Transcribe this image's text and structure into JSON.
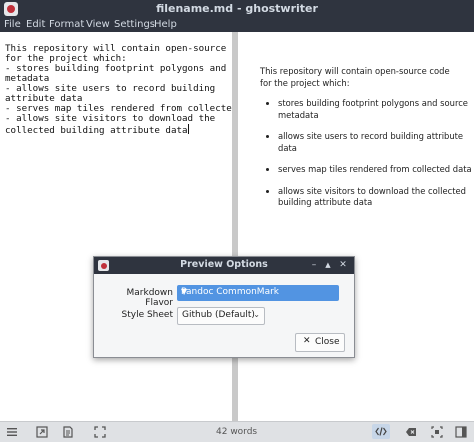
{
  "window": {
    "title": "filename.md - ghostwriter"
  },
  "menu": {
    "file": "File",
    "edit": "Edit",
    "format": "Format",
    "view": "View",
    "settings": "Settings",
    "help": "Help"
  },
  "editor": {
    "text": "This repository will contain open-source code\nfor the project which:\n- stores building footprint polygons and source\nmetadata\n- allows site users to record building\nattribute data\n- serves map tiles rendered from collected data\n- allows site visitors to download the\ncollected building attribute data"
  },
  "preview": {
    "intro": "This repository will contain open-source code for the project which:",
    "items": [
      "stores building footprint polygons and source metadata",
      "allows site users to record building attribute data",
      "serves map tiles rendered from collected data",
      "allows site visitors to download the collected building attribute data"
    ]
  },
  "status": {
    "word_count": "42 words"
  },
  "dialog": {
    "title": "Preview Options",
    "flavor_label": "Markdown Flavor",
    "flavor_value": "Pandoc CommonMark",
    "stylesheet_label": "Style Sheet",
    "stylesheet_value": "Github (Default)",
    "close_label": "Close"
  },
  "icons": {
    "app": "ghostwriter-icon",
    "menu_toggle": "hamburger-icon",
    "export": "export-icon",
    "hemingway": "document-icon",
    "fullscreen": "fullscreen-icon",
    "html_preview": "code-icon",
    "backspace": "backspace-icon",
    "focus": "focus-icon",
    "outline": "outline-icon"
  },
  "colors": {
    "titlebar": "#2f343f",
    "accent": "#5294e2",
    "app_icon_red": "#c0303a"
  }
}
